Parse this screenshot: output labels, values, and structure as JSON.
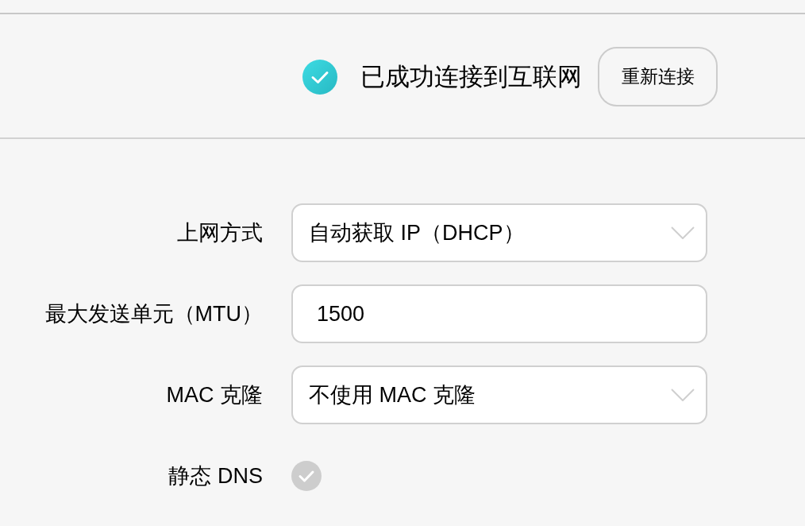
{
  "status": {
    "connected": true,
    "message": "已成功连接到互联网",
    "reconnect_button": "重新连接"
  },
  "form": {
    "fields": [
      {
        "kind": "select",
        "label": "上网方式",
        "value": "自动获取 IP（DHCP）"
      },
      {
        "kind": "input",
        "label": "最大发送单元（MTU）",
        "value": "1500"
      },
      {
        "kind": "select",
        "label": "MAC 克隆",
        "value": "不使用 MAC 克隆"
      },
      {
        "kind": "checkbox",
        "label": "静态 DNS",
        "checked": false
      }
    ]
  }
}
